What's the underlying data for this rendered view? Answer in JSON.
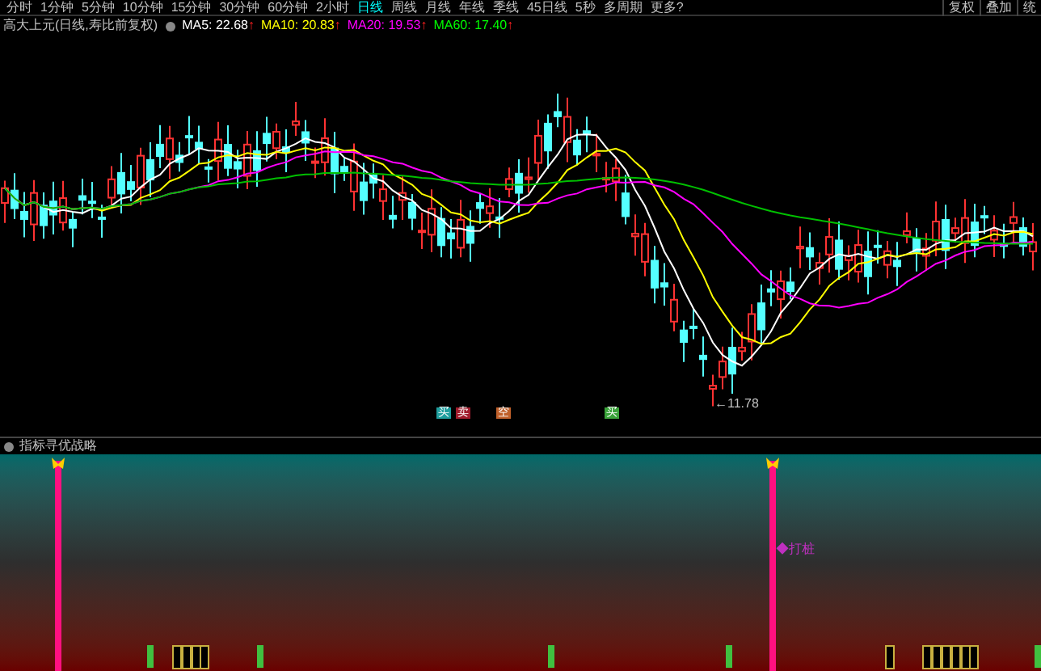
{
  "toolbar": {
    "tabs": [
      {
        "label": "分时",
        "selected": false
      },
      {
        "label": "1分钟",
        "selected": false
      },
      {
        "label": "5分钟",
        "selected": false
      },
      {
        "label": "10分钟",
        "selected": false
      },
      {
        "label": "15分钟",
        "selected": false
      },
      {
        "label": "30分钟",
        "selected": false
      },
      {
        "label": "60分钟",
        "selected": false
      },
      {
        "label": "2小时",
        "selected": false
      },
      {
        "label": "日线",
        "selected": true
      },
      {
        "label": "周线",
        "selected": false
      },
      {
        "label": "月线",
        "selected": false
      },
      {
        "label": "年线",
        "selected": false
      },
      {
        "label": "季线",
        "selected": false
      },
      {
        "label": "45日线",
        "selected": false
      },
      {
        "label": "5秒",
        "selected": false
      },
      {
        "label": "多周期",
        "selected": false
      },
      {
        "label": "更多?",
        "selected": false
      }
    ],
    "buttons": [
      "复权",
      "叠加",
      "统"
    ]
  },
  "chart": {
    "title": "高大上元(日线,寿比前复权)",
    "indicators": [
      {
        "label": "MA5: 22.68",
        "trend": "↑",
        "color": "#ffffff"
      },
      {
        "label": "MA10: 20.83",
        "trend": "↑",
        "color": "#ffff00"
      },
      {
        "label": "MA20: 19.53",
        "trend": "↑",
        "color": "#ff00ff"
      },
      {
        "label": "MA60: 17.40",
        "trend": "↑",
        "color": "#00ff00"
      }
    ],
    "low_label": "←11.78",
    "signals": [
      {
        "label": "买",
        "color": "#1f9e9e"
      },
      {
        "label": "卖",
        "color": "#a01c2c"
      },
      {
        "label": "空",
        "color": "#c0602a"
      },
      {
        "label": "买",
        "color": "#3aa33a"
      }
    ]
  },
  "indicator_panel": {
    "title": "指标寻优战略",
    "annotation": "◆打桩"
  }
}
